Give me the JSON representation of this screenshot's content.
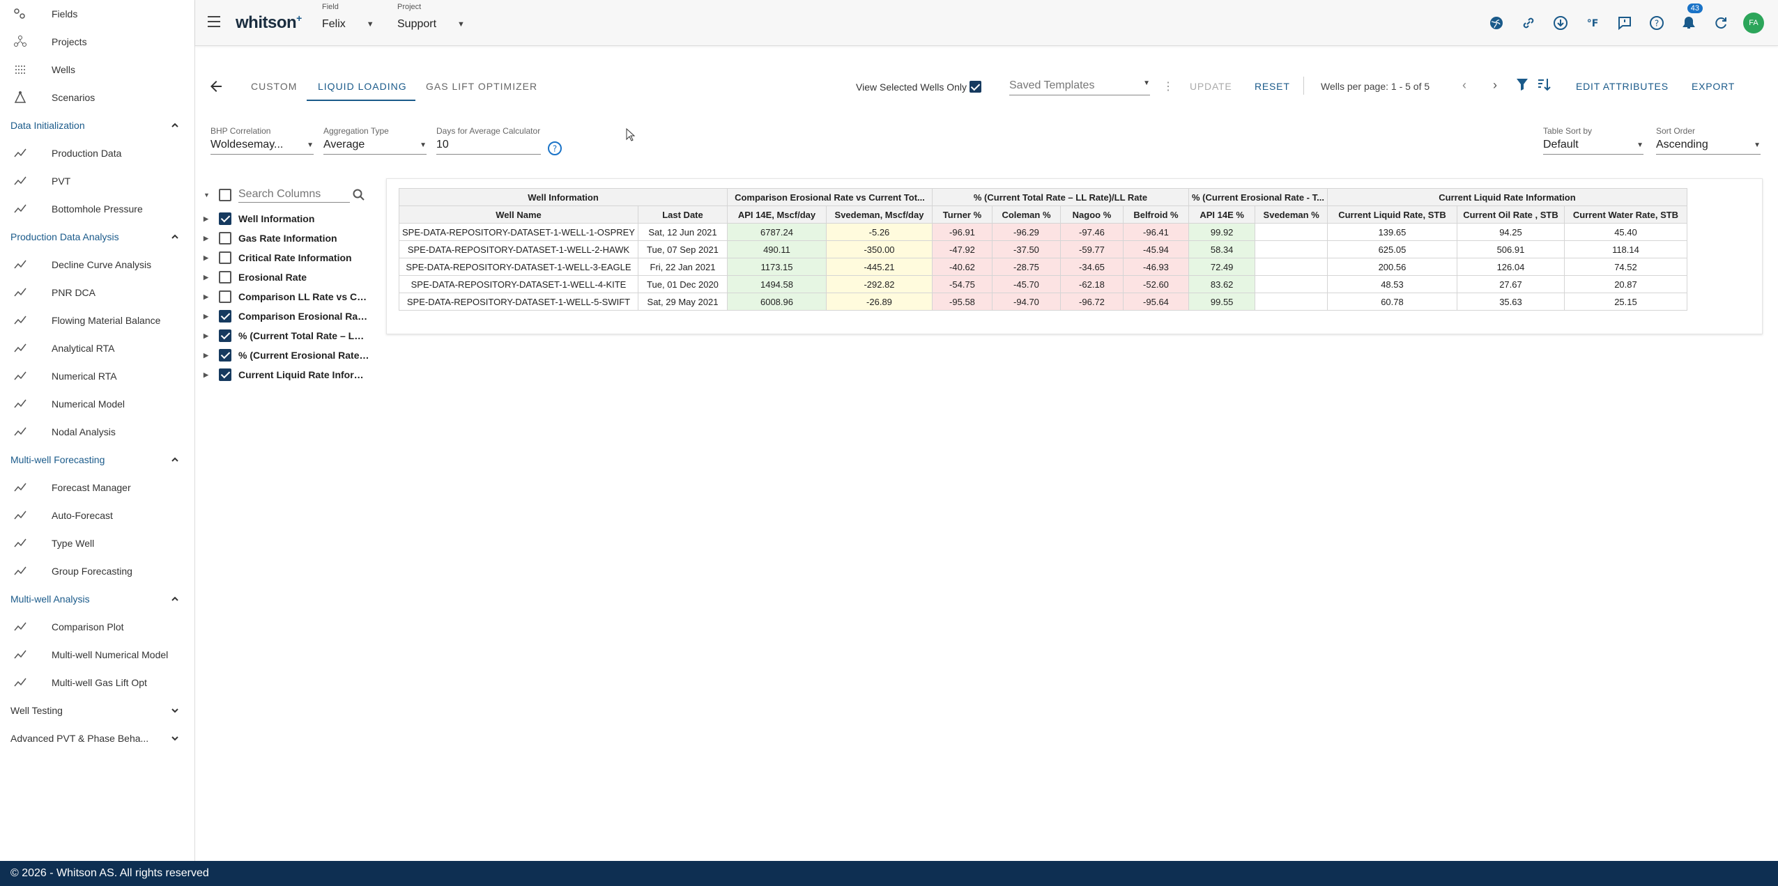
{
  "app": {
    "logo": "whitson",
    "logo_sup": "+"
  },
  "topbar": {
    "field": {
      "caption": "Field",
      "value": "Felix"
    },
    "project": {
      "caption": "Project",
      "value": "Support"
    },
    "notifications": "43",
    "avatar": "FA",
    "icons": [
      "globe-icon",
      "link-icon",
      "download-icon",
      "fahrenheit-icon",
      "feedback-icon",
      "help-icon",
      "bell-icon",
      "refresh-icon"
    ]
  },
  "sidebar": {
    "top_items": [
      {
        "label": "Fields",
        "icon": "fields-icon"
      },
      {
        "label": "Projects",
        "icon": "projects-icon"
      },
      {
        "label": "Wells",
        "icon": "wells-icon"
      },
      {
        "label": "Scenarios",
        "icon": "scenarios-icon"
      }
    ],
    "sections": [
      {
        "title": "Data Initialization",
        "items": [
          "Production Data",
          "PVT",
          "Bottomhole Pressure"
        ]
      },
      {
        "title": "Production Data Analysis",
        "items": [
          "Decline Curve Analysis",
          "PNR DCA",
          "Flowing Material Balance",
          "Analytical RTA",
          "Numerical RTA",
          "Numerical Model",
          "Nodal Analysis"
        ]
      },
      {
        "title": "Multi-well Forecasting",
        "items": [
          "Forecast Manager",
          "Auto-Forecast",
          "Type Well",
          "Group Forecasting"
        ]
      },
      {
        "title": "Multi-well Analysis",
        "items": [
          "Comparison Plot",
          "Multi-well Numerical Model",
          "Multi-well Gas Lift Opt"
        ]
      }
    ],
    "collapsed": [
      "Well Testing",
      "Advanced PVT & Phase Beha..."
    ]
  },
  "tabs": [
    "CUSTOM",
    "LIQUID LOADING",
    "GAS LIFT OPTIMIZER"
  ],
  "toolbar": {
    "view_selected": "View Selected Wells Only",
    "saved_templates": "Saved Templates",
    "update": "UPDATE",
    "reset": "RESET",
    "paging": "Wells per page: 1 - 5 of 5",
    "edit": "EDIT ATTRIBUTES",
    "export": "EXPORT"
  },
  "controls": {
    "bhp": {
      "caption": "BHP Correlation",
      "value": "Woldesemay..."
    },
    "agg": {
      "caption": "Aggregation Type",
      "value": "Average"
    },
    "days": {
      "caption": "Days for Average Calculator",
      "value": "10"
    },
    "sortby": {
      "caption": "Table Sort by",
      "value": "Default"
    },
    "order": {
      "caption": "Sort Order",
      "value": "Ascending"
    }
  },
  "tree": {
    "search_placeholder": "Search Columns",
    "items": [
      {
        "label": "Well Information",
        "checked": true
      },
      {
        "label": "Gas Rate Information",
        "checked": false
      },
      {
        "label": "Critical Rate Information",
        "checked": false
      },
      {
        "label": "Erosional Rate",
        "checked": false
      },
      {
        "label": "Comparison LL Rate vs Curr...",
        "checked": false
      },
      {
        "label": "Comparison Erosional Rate ...",
        "checked": true
      },
      {
        "label": "% (Current Total Rate – LL R...",
        "checked": true
      },
      {
        "label": "% (Current Erosional Rate - ...",
        "checked": true
      },
      {
        "label": "Current Liquid Rate Informa...",
        "checked": true
      }
    ]
  },
  "table": {
    "groups": [
      {
        "label": "Well Information",
        "span": 2
      },
      {
        "label": "Comparison Erosional Rate vs Current Tot...",
        "span": 2
      },
      {
        "label": "% (Current Total Rate – LL Rate)/LL Rate",
        "span": 4
      },
      {
        "label": "% (Current Erosional Rate - T...",
        "span": 2
      },
      {
        "label": "Current Liquid Rate Information",
        "span": 3
      }
    ],
    "headers": [
      "Well Name",
      "Last Date",
      "API 14E, Mscf/day",
      "Svedeman, Mscf/day",
      "Turner %",
      "Coleman %",
      "Nagoo %",
      "Belfroid %",
      "API 14E %",
      "Svedeman %",
      "Current Liquid Rate, STB",
      "Current Oil Rate , STB",
      "Current Water Rate, STB"
    ],
    "rows": [
      [
        "SPE-DATA-REPOSITORY-DATASET-1-WELL-1-OSPREY",
        "Sat, 12 Jun 2021",
        "6787.24",
        "-5.26",
        "-96.91",
        "-96.29",
        "-97.46",
        "-96.41",
        "99.92",
        "",
        "139.65",
        "94.25",
        "45.40"
      ],
      [
        "SPE-DATA-REPOSITORY-DATASET-1-WELL-2-HAWK",
        "Tue, 07 Sep 2021",
        "490.11",
        "-350.00",
        "-47.92",
        "-37.50",
        "-59.77",
        "-45.94",
        "58.34",
        "",
        "625.05",
        "506.91",
        "118.14"
      ],
      [
        "SPE-DATA-REPOSITORY-DATASET-1-WELL-3-EAGLE",
        "Fri, 22 Jan 2021",
        "1173.15",
        "-445.21",
        "-40.62",
        "-28.75",
        "-34.65",
        "-46.93",
        "72.49",
        "",
        "200.56",
        "126.04",
        "74.52"
      ],
      [
        "SPE-DATA-REPOSITORY-DATASET-1-WELL-4-KITE",
        "Tue, 01 Dec 2020",
        "1494.58",
        "-292.82",
        "-54.75",
        "-45.70",
        "-62.18",
        "-52.60",
        "83.62",
        "",
        "48.53",
        "27.67",
        "20.87"
      ],
      [
        "SPE-DATA-REPOSITORY-DATASET-1-WELL-5-SWIFT",
        "Sat, 29 May 2021",
        "6008.96",
        "-26.89",
        "-95.58",
        "-94.70",
        "-96.72",
        "-95.64",
        "99.55",
        "",
        "60.78",
        "35.63",
        "25.15"
      ]
    ],
    "col_classes": [
      "",
      "",
      "g",
      "y",
      "r",
      "r",
      "r",
      "r",
      "g",
      "",
      "",
      "",
      ""
    ]
  },
  "footer": "© 2026 - Whitson AS. All rights reserved"
}
